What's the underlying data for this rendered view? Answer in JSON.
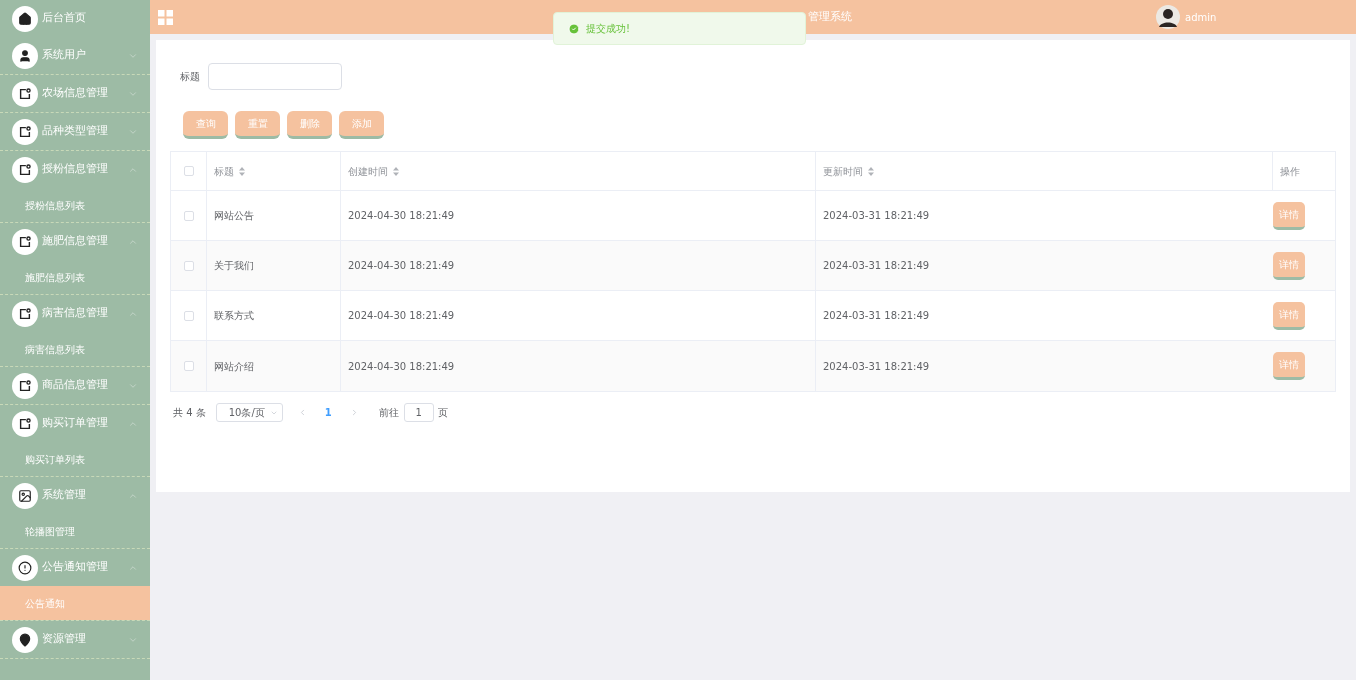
{
  "header": {
    "title": "管理系统",
    "user": "admin"
  },
  "toast": {
    "kind": "success",
    "message": "提交成功!"
  },
  "sidebar": {
    "items": [
      {
        "label": "后台首页",
        "kind": "home"
      },
      {
        "label": "系统用户",
        "kind": "user",
        "expanded": false
      },
      {
        "label": "农场信息管理",
        "kind": "form",
        "expanded": false
      },
      {
        "label": "品种类型管理",
        "kind": "form",
        "expanded": false
      },
      {
        "label": "授粉信息管理",
        "kind": "form",
        "expanded": true,
        "children": [
          {
            "label": "授粉信息列表",
            "selected": false
          }
        ]
      },
      {
        "label": "施肥信息管理",
        "kind": "form",
        "expanded": true,
        "children": [
          {
            "label": "施肥信息列表",
            "selected": false
          }
        ]
      },
      {
        "label": "病害信息管理",
        "kind": "form",
        "expanded": true,
        "children": [
          {
            "label": "病害信息列表",
            "selected": false
          }
        ]
      },
      {
        "label": "商品信息管理",
        "kind": "form",
        "expanded": false
      },
      {
        "label": "购买订单管理",
        "kind": "form",
        "expanded": true,
        "children": [
          {
            "label": "购买订单列表",
            "selected": false
          }
        ]
      },
      {
        "label": "系统管理",
        "kind": "image",
        "expanded": true,
        "children": [
          {
            "label": "轮播图管理",
            "selected": false
          }
        ]
      },
      {
        "label": "公告通知管理",
        "kind": "info",
        "expanded": true,
        "children": [
          {
            "label": "公告通知",
            "selected": true
          }
        ]
      },
      {
        "label": "资源管理",
        "kind": "bulb",
        "expanded": false
      }
    ]
  },
  "search": {
    "label": "标题"
  },
  "buttons": [
    "查询",
    "重置",
    "删除",
    "添加"
  ],
  "table": {
    "header_checked": false,
    "columns": [
      {
        "label": "标题",
        "sortable": true
      },
      {
        "label": "创建时间",
        "sortable": true
      },
      {
        "label": "更新时间",
        "sortable": true
      },
      {
        "label": "操作",
        "sortable": false
      }
    ],
    "rows": [
      {
        "checked": false,
        "title": "网站公告",
        "created": "2024-04-30 18:21:49",
        "updated": "2024-03-31 18:21:49",
        "action": "详情"
      },
      {
        "checked": false,
        "title": "关于我们",
        "created": "2024-04-30 18:21:49",
        "updated": "2024-03-31 18:21:49",
        "action": "详情"
      },
      {
        "checked": false,
        "title": "联系方式",
        "created": "2024-04-30 18:21:49",
        "updated": "2024-03-31 18:21:49",
        "action": "详情"
      },
      {
        "checked": false,
        "title": "网站介绍",
        "created": "2024-04-30 18:21:49",
        "updated": "2024-03-31 18:21:49",
        "action": "详情"
      }
    ]
  },
  "pagination": {
    "total": "共 4 条",
    "page_size": "10条/页",
    "pages": [
      {
        "label": "1",
        "selected": true
      }
    ],
    "goto_label": "前往",
    "goto_value": "1",
    "goto_suffix": "页"
  }
}
